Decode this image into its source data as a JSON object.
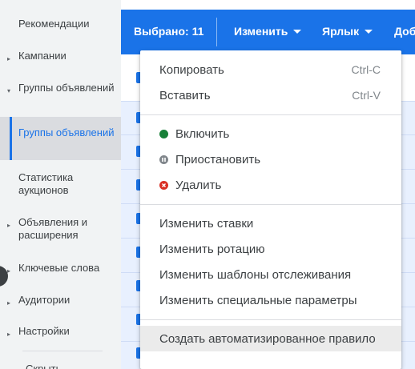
{
  "sidebar": {
    "items": [
      {
        "label": "Рекомендации"
      },
      {
        "label": "Кампании"
      },
      {
        "label": "Группы объявлений"
      },
      {
        "label": "Группы объявлений"
      },
      {
        "label": "Статистика аукционов"
      },
      {
        "label": "Объявления и расширения"
      },
      {
        "label": "Ключевые слова"
      },
      {
        "label": "Аудитории"
      },
      {
        "label": "Настройки"
      },
      {
        "label": "Скрыть"
      }
    ]
  },
  "toolbar": {
    "selected": "Выбрано: 11",
    "edit": "Изменить",
    "label": "Ярлык",
    "add": "Доб"
  },
  "menu": {
    "copy": {
      "label": "Копировать",
      "shortcut": "Ctrl-C"
    },
    "paste": {
      "label": "Вставить",
      "shortcut": "Ctrl-V"
    },
    "enable": {
      "label": "Включить",
      "color": "#188038"
    },
    "pause": {
      "label": "Приостановить",
      "color": "#80868b"
    },
    "remove": {
      "label": "Удалить",
      "color": "#d93025"
    },
    "change_bids": "Изменить ставки",
    "change_rotation": "Изменить ротацию",
    "change_tracking": "Изменить шаблоны отслеживания",
    "change_params": "Изменить специальные параметры",
    "create_rule": "Создать автоматизированное правило"
  },
  "colors": {
    "accent": "#1a73e8"
  }
}
